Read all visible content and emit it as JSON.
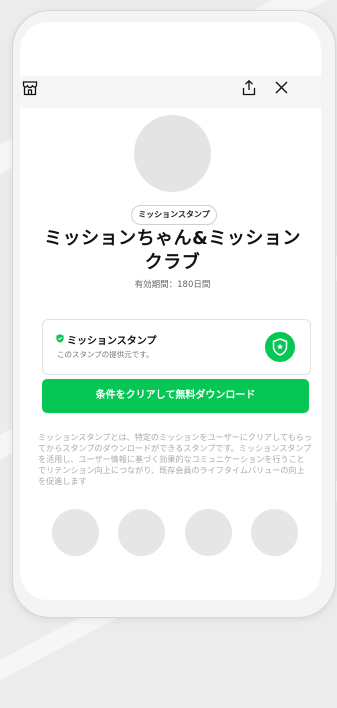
{
  "header": {
    "store_icon": "store-icon",
    "share_icon": "share-icon",
    "close_icon": "close-icon"
  },
  "sticker": {
    "type_label": "ミッションスタンプ",
    "title_line1": "ミッションちゃん&ミッション",
    "title_line2": "クラブ",
    "period": "有効期間：180日間"
  },
  "provider": {
    "name": "ミッションスタンプ",
    "description": "このスタンプの提供元です。",
    "badge_icon": "shield-check-icon",
    "logo_icon": "shield-star-icon"
  },
  "download_button": "条件をクリアして無料ダウンロード",
  "description": "ミッションスタンプとは、特定のミッションをユーザーにクリアしてもらってからスタンプのダウンロードができるスタンプです。ミッションスタンプを活用し、ユーザー情報に基づく効果的なコミュニケーションを行うことでリテンション向上につながり、既存会員のライフタイムバリューの向上を促進します",
  "colors": {
    "accent": "#06c755",
    "background": "#ececec"
  }
}
